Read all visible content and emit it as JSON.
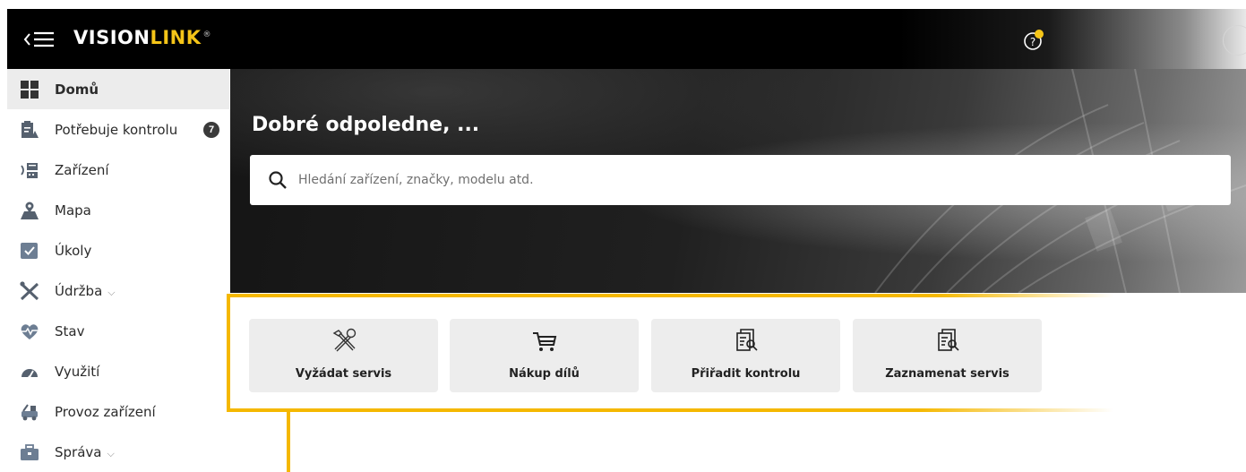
{
  "header": {
    "logo_text_a": "VISION",
    "logo_text_b": "LINK",
    "logo_reg": "®"
  },
  "sidebar": {
    "items": [
      {
        "label": "Domů",
        "icon": "dashboard-grid-icon"
      },
      {
        "label": "Potřebuje kontrolu",
        "icon": "inspection-clipboard-icon",
        "badge": "7"
      },
      {
        "label": "Zařízení",
        "icon": "machine-icon"
      },
      {
        "label": "Mapa",
        "icon": "map-icon"
      },
      {
        "label": "Úkoly",
        "icon": "tasks-icon"
      },
      {
        "label": "Údržba",
        "icon": "wrench-screwdriver-icon"
      },
      {
        "label": "Stav",
        "icon": "health-heart-icon"
      },
      {
        "label": "Využití",
        "icon": "gauge-icon"
      },
      {
        "label": "Provoz zařízení",
        "icon": "operation-icon"
      },
      {
        "label": "Správa",
        "icon": "briefcase-icon"
      }
    ]
  },
  "hero": {
    "greeting": "Dobré odpoledne, ...",
    "search_placeholder": "Hledání zařízení, značky, modelu atd."
  },
  "quick_actions": [
    {
      "label": "Vyžádat servis",
      "icon": "tools-icon"
    },
    {
      "label": "Nákup dílů",
      "icon": "cart-icon"
    },
    {
      "label": "Přiřadit kontrolu",
      "icon": "document-search-icon"
    },
    {
      "label": "Zaznamenat servis",
      "icon": "document-search-icon"
    }
  ],
  "colors": {
    "accent": "#f5b800",
    "topbar": "#000000",
    "sidebar_active": "#ececec",
    "action_bg": "#ededed"
  }
}
